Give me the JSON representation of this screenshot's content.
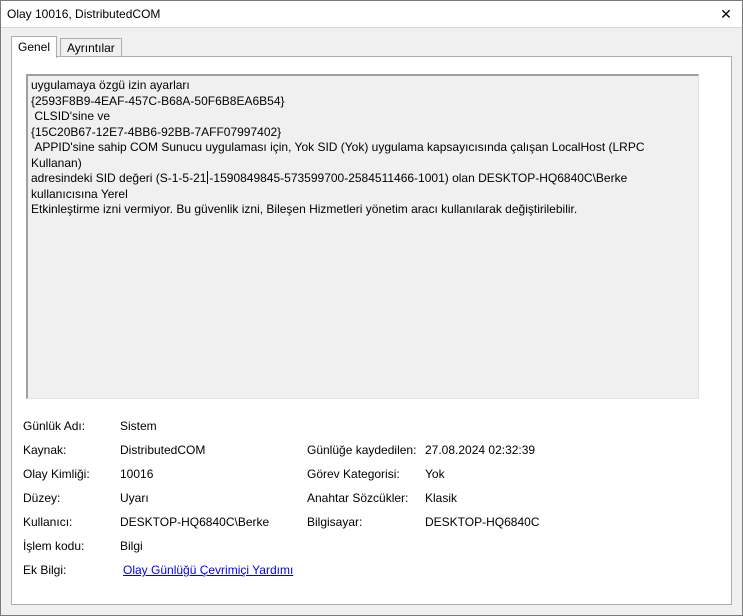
{
  "window": {
    "title": "Olay 10016, DistributedCOM",
    "close_glyph": "✕"
  },
  "tabs": [
    {
      "label": "Genel",
      "active": true
    },
    {
      "label": "Ayrıntılar",
      "active": false
    }
  ],
  "description": {
    "lines": [
      "uygulamaya özgü izin ayarları",
      "{2593F8B9-4EAF-457C-B68A-50F6B8EA6B54}",
      " CLSID'sine ve",
      "{15C20B67-12E7-4BB6-92BB-7AFF07997402}",
      " APPID'sine sahip COM Sunucu uygulaması için, Yok SID (Yok) uygulama kapsayıcısında çalışan LocalHost (LRPC Kullanan)",
      "Etkinleştirme izni vermiyor. Bu güvenlik izni, Bileşen Hizmetleri yönetim aracı kullanılarak değiştirilebilir."
    ],
    "line_sid_before_caret": "adresindeki SID değeri (S-1-5-21",
    "line_sid_after_caret": "-1590849845-573599700-2584511466-1001) olan DESKTOP-HQ6840C\\Berke kullanıcısına Yerel"
  },
  "fields": {
    "log_name_label": "Günlük Adı:",
    "log_name_value": "Sistem",
    "source_label": "Kaynak:",
    "source_value": "DistributedCOM",
    "logged_label": "Günlüğe kaydedilen:",
    "logged_value": "27.08.2024 02:32:39",
    "event_id_label": "Olay Kimliği:",
    "event_id_value": "10016",
    "task_category_label": "Görev Kategorisi:",
    "task_category_value": "Yok",
    "level_label": "Düzey:",
    "level_value": "Uyarı",
    "keywords_label": "Anahtar Sözcükler:",
    "keywords_value": "Klasik",
    "user_label": "Kullanıcı:",
    "user_value": "DESKTOP-HQ6840C\\Berke",
    "computer_label": "Bilgisayar:",
    "computer_value": "DESKTOP-HQ6840C",
    "opcode_label": "İşlem kodu:",
    "opcode_value": "Bilgi",
    "more_info_label": "Ek Bilgi:",
    "more_info_link": "Olay Günlüğü Çevrimiçi Yardımı"
  }
}
